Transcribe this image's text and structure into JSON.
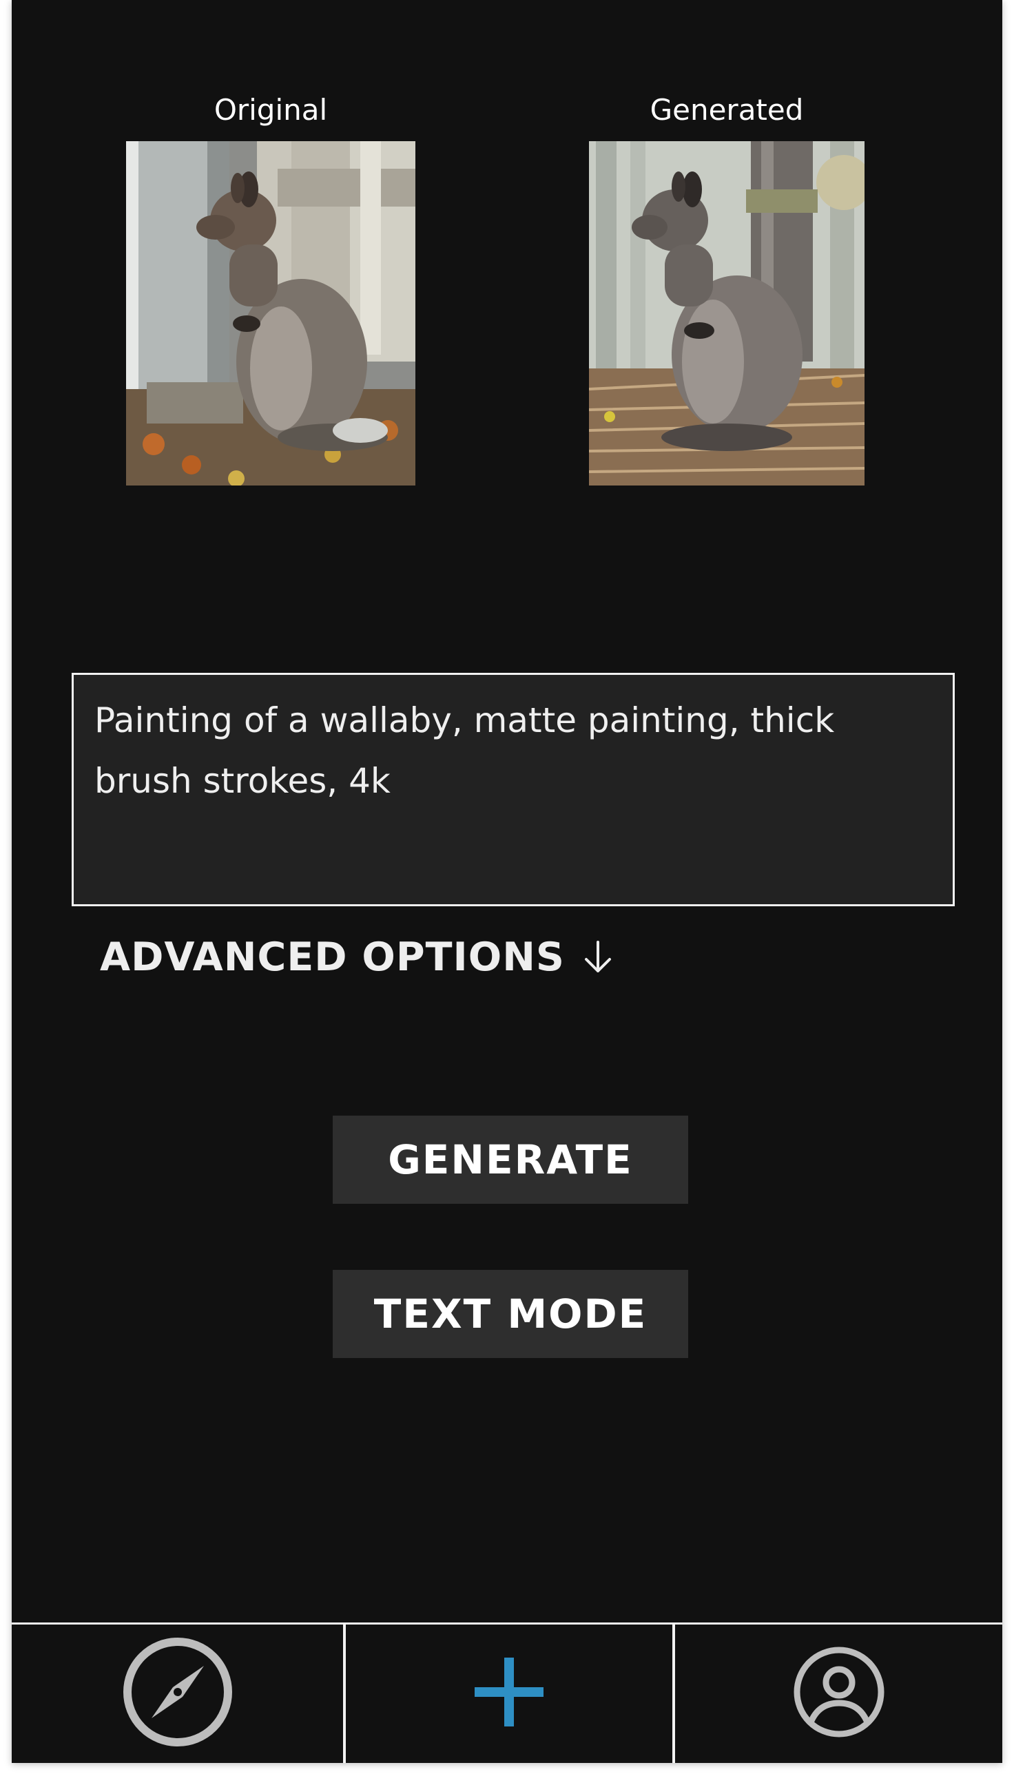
{
  "images": {
    "original_label": "Original",
    "generated_label": "Generated"
  },
  "prompt": {
    "value": "Painting of a wallaby, matte painting, thick brush strokes, 4k"
  },
  "advanced_options": {
    "label": "ADVANCED OPTIONS",
    "icon": "arrow-down-icon"
  },
  "buttons": {
    "generate_label": "GENERATE",
    "text_mode_label": "TEXT MODE"
  },
  "bottom_nav": {
    "items": [
      {
        "icon": "compass-icon"
      },
      {
        "icon": "plus-icon"
      },
      {
        "icon": "user-circle-icon"
      }
    ]
  },
  "colors": {
    "background": "#111111",
    "input_background": "#222222",
    "button_background": "#2e2e2e",
    "accent": "#2e8fc4",
    "icon_gray": "#bdbdbd"
  }
}
